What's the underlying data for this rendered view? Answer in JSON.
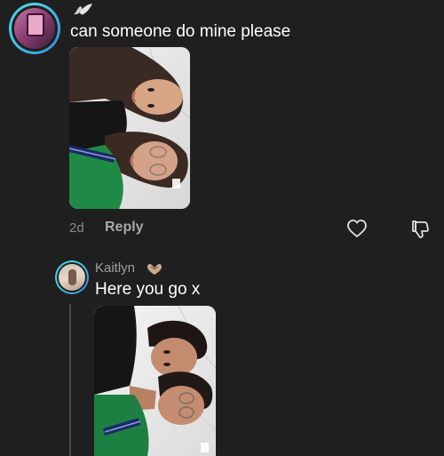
{
  "comment1": {
    "text": "can someone do mine please",
    "age": "2d",
    "reply_label": "Reply"
  },
  "reply1": {
    "username": "Kaitlyn",
    "text": "Here you go x"
  },
  "icons": {
    "username_badge": "angel-wing-icon",
    "kaitlyn_badge": "heart-hands-icon",
    "like": "heart-outline-icon",
    "dislike": "thumbs-down-icon"
  },
  "colors": {
    "background": "#1f1f1f",
    "avatar_ring": "#4fd4e6"
  }
}
